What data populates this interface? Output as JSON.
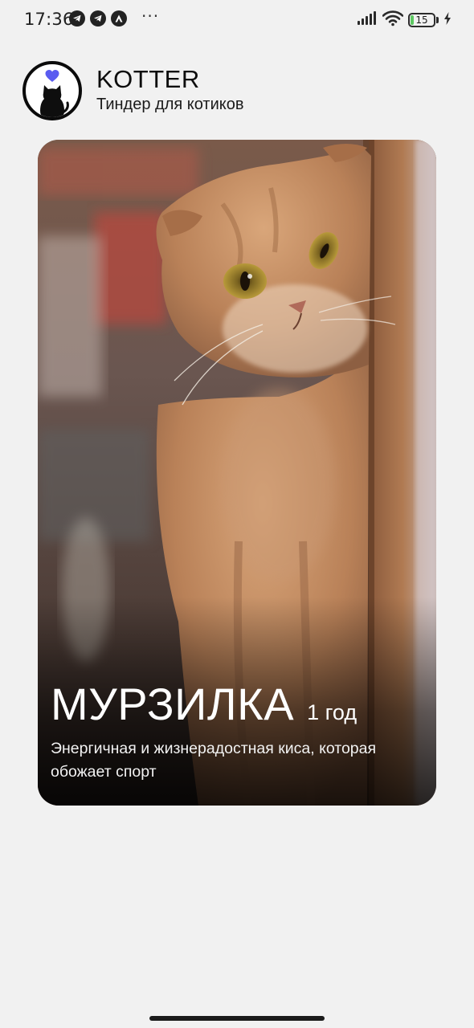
{
  "status_bar": {
    "time": "17:36",
    "left_icons": [
      "telegram-icon",
      "telegram-icon",
      "app-a-icon"
    ],
    "more": "···",
    "right_icons": [
      "signal-icon",
      "wifi-icon",
      "battery-icon",
      "charging-icon"
    ],
    "battery_level": "15",
    "battery_color": "#5cc861"
  },
  "header": {
    "logo_icon": "cat-heart-logo",
    "title": "KOTTER",
    "subtitle": "Тиндер для котиков",
    "heart_color": "#5a5cf0"
  },
  "card": {
    "photo": "cat-photo",
    "name": "МУРЗИЛКА",
    "age": "1 год",
    "description": "Энергичная и жизнерадостная киса, которая обожает спорт"
  }
}
